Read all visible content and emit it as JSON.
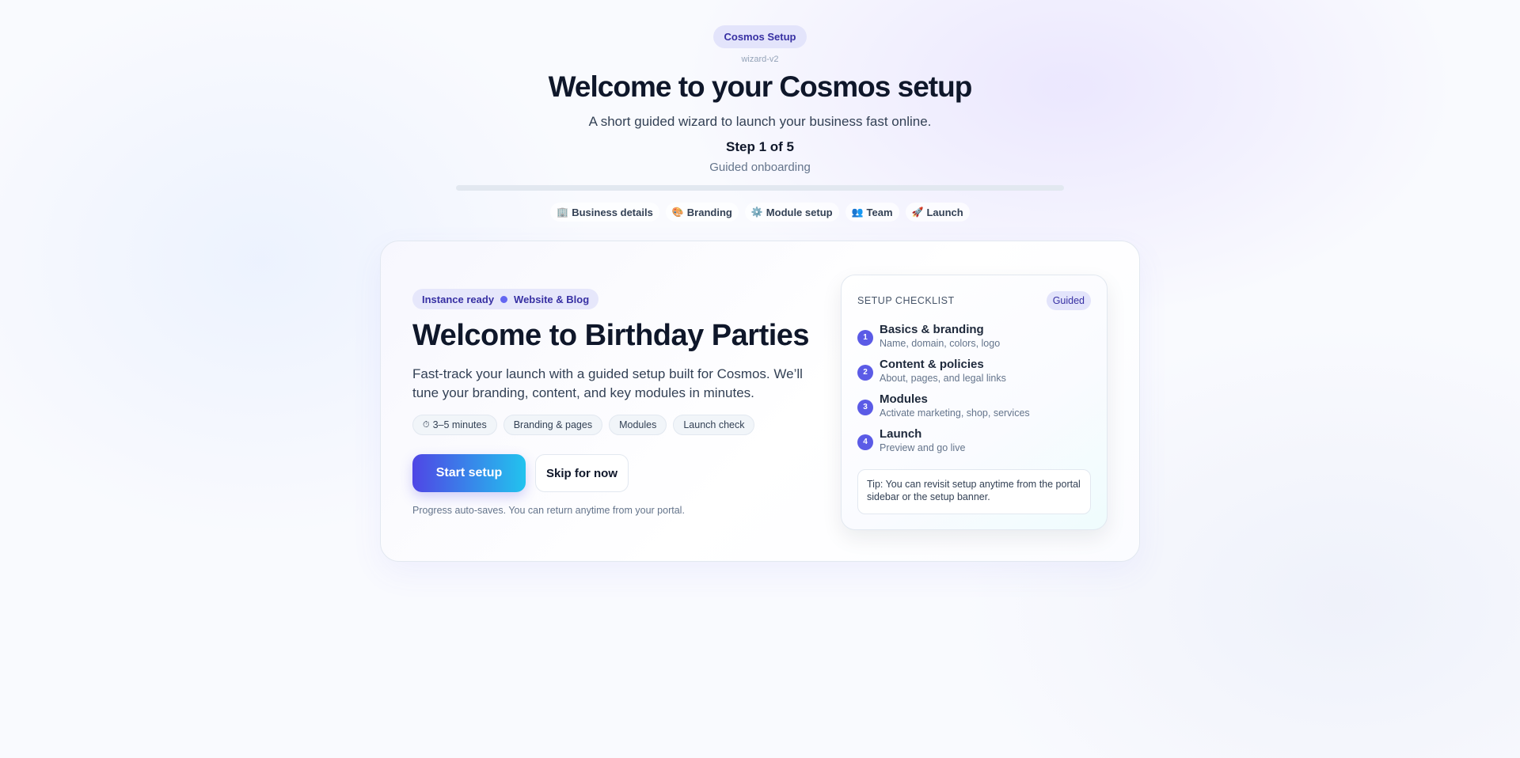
{
  "app": {
    "pill": "Cosmos Setup",
    "version": "wizard-v2"
  },
  "header": {
    "title": "Welcome to your Cosmos setup",
    "subtitle": "A short guided wizard to launch your business fast online.",
    "step_label": "Step 1 of 5",
    "step_caption": "Guided onboarding",
    "progress": 0
  },
  "steps": [
    {
      "icon": "🏢",
      "label": "Business details"
    },
    {
      "icon": "🎨",
      "label": "Branding"
    },
    {
      "icon": "⚙️",
      "label": "Module setup"
    },
    {
      "icon": "👥",
      "label": "Team"
    },
    {
      "icon": "🚀",
      "label": "Launch"
    }
  ],
  "hero": {
    "badge_status": "Instance ready",
    "badge_type": "Website & Blog",
    "title": "Welcome to Birthday Parties",
    "description": "Fast-track your launch with a guided setup built for Cosmos. We’ll tune your branding, content, and key modules in minutes.",
    "tags": [
      {
        "icon": "⏱",
        "label": "3–5 minutes"
      },
      {
        "icon": "",
        "label": "Branding & pages"
      },
      {
        "icon": "",
        "label": "Modules"
      },
      {
        "icon": "",
        "label": "Launch check"
      }
    ],
    "start_label": "Start setup",
    "skip_label": "Skip for now",
    "autosave_note": "Progress auto-saves. You can return anytime from your portal."
  },
  "checklist": {
    "title": "SETUP CHECKLIST",
    "badge": "Guided",
    "items": [
      {
        "num": "1",
        "title": "Basics & branding",
        "sub": "Name, domain, colors, logo"
      },
      {
        "num": "2",
        "title": "Content & policies",
        "sub": "About, pages, and legal links"
      },
      {
        "num": "3",
        "title": "Modules",
        "sub": "Activate marketing, shop, services"
      },
      {
        "num": "4",
        "title": "Launch",
        "sub": "Preview and go live"
      }
    ],
    "tip": "Tip: You can revisit setup anytime from the portal sidebar or the setup banner."
  },
  "colors": {
    "accent": "#4f46e5",
    "accent_end": "#22d3ee",
    "pill_bg": "#e3e4fb",
    "pill_text": "#3730a3"
  }
}
